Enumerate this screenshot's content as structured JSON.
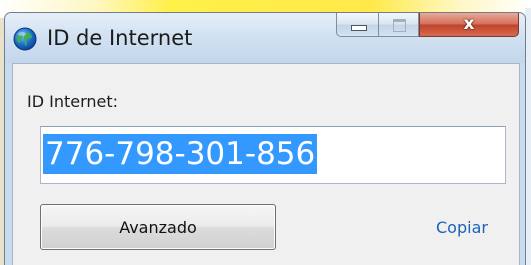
{
  "window": {
    "title": "ID de Internet",
    "icon": "globe-icon",
    "controls": [
      "minimize-icon",
      "maximize-icon",
      "close-icon"
    ],
    "close_glyph": "x"
  },
  "form": {
    "label": "ID Internet:",
    "internet_id": "776-798-301-856",
    "id_selected": true
  },
  "actions": {
    "advanced_label": "Avanzado",
    "copy_label": "Copiar"
  },
  "colors": {
    "selection": "#3399ff",
    "link": "#1a64b8",
    "close_button": "#c0432b",
    "titlebar": "#c9dcef"
  }
}
